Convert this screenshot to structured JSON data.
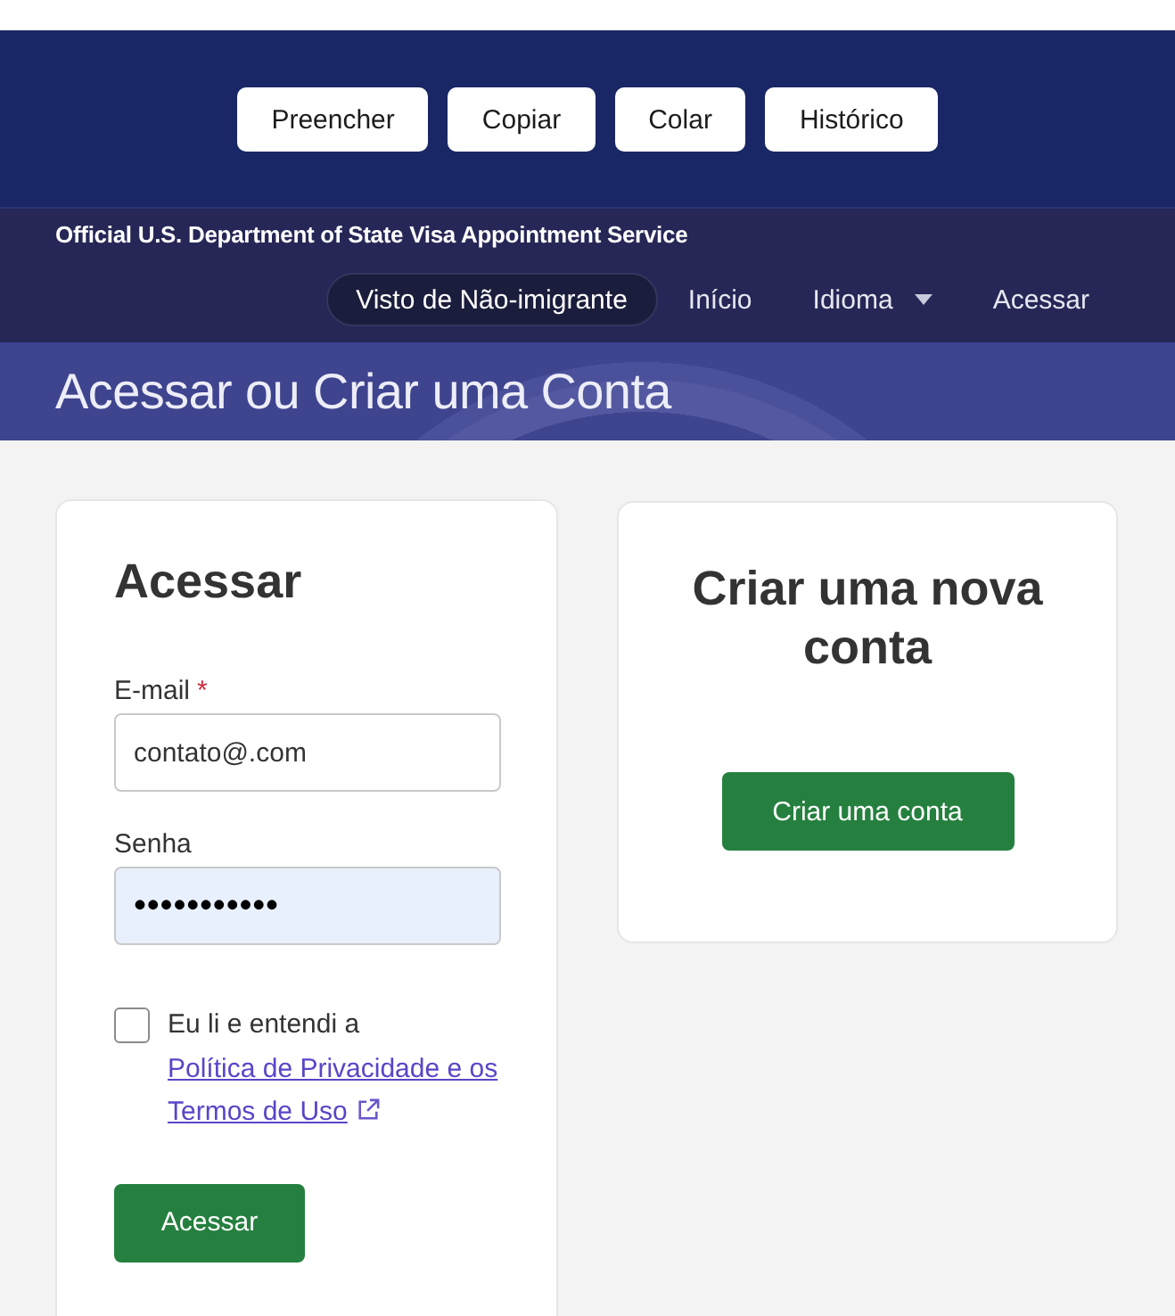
{
  "toolbar": {
    "buttons": [
      "Preencher",
      "Copiar",
      "Colar",
      "Histórico"
    ]
  },
  "header": {
    "title": "Official U.S. Department of State Visa Appointment Service",
    "nav": [
      {
        "label": "Visto de Não-imigrante",
        "kind": "link",
        "selected": true
      },
      {
        "label": "Início",
        "kind": "link",
        "selected": false
      },
      {
        "label": "Idioma",
        "kind": "dropdown",
        "selected": false
      },
      {
        "label": "Acessar",
        "kind": "link",
        "selected": false
      }
    ]
  },
  "banner": {
    "title": "Acessar ou Criar uma Conta"
  },
  "login": {
    "heading": "Acessar",
    "fields": [
      {
        "label": "E-mail",
        "required_mark": "*",
        "value": "contato@.com",
        "autofilled": false,
        "kind": "text"
      },
      {
        "label": "Senha",
        "value": "•••••••••••",
        "autofilled": true,
        "kind": "password"
      }
    ],
    "consent": {
      "checked": false,
      "text": "Eu li e entendi a",
      "link": "Política de Privacidade e os Termos de Uso"
    },
    "button": "Acessar"
  },
  "signup": {
    "heading": "Criar uma nova conta",
    "button": "Criar uma conta"
  }
}
